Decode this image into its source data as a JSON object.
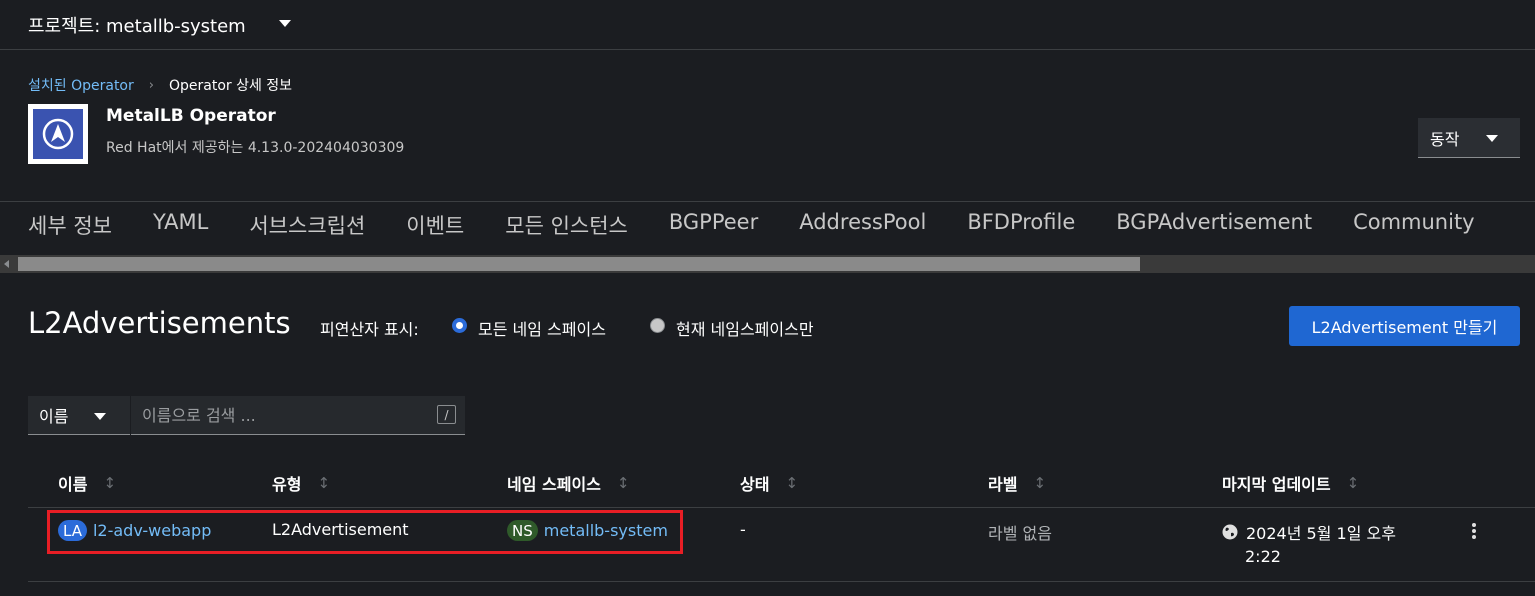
{
  "project": {
    "label": "프로젝트: metallb-system"
  },
  "breadcrumb": {
    "parent": "설치된 Operator",
    "current": "Operator 상세 정보"
  },
  "operator": {
    "name": "MetalLB Operator",
    "subtitle": "Red Hat에서 제공하는 4.13.0-202404030309"
  },
  "actions": {
    "label": "동작"
  },
  "tabs": [
    "세부 정보",
    "YAML",
    "서브스크립션",
    "이벤트",
    "모든 인스턴스",
    "BGPPeer",
    "AddressPool",
    "BFDProfile",
    "BGPAdvertisement",
    "Community"
  ],
  "page": {
    "title": "L2Advertisements"
  },
  "filter": {
    "label": "피연산자 표시:",
    "option_all": "모든 네임 스페이스",
    "option_current": "현재 네임스페이스만"
  },
  "create_button": "L2Advertisement 만들기",
  "search": {
    "select_value": "이름",
    "placeholder": "이름으로 검색 ...",
    "shortcut": "/"
  },
  "table": {
    "headers": [
      "이름",
      "유형",
      "네임 스페이스",
      "상태",
      "라벨",
      "마지막 업데이트"
    ],
    "rows": [
      {
        "name_badge": "LA",
        "name": "l2-adv-webapp",
        "type": "L2Advertisement",
        "ns_badge": "NS",
        "namespace": "metallb-system",
        "status": "-",
        "labels": "라벨 없음",
        "updated_line1": "2024년 5월 1일 오후",
        "updated_line2": "2:22"
      }
    ]
  },
  "colors": {
    "accent": "#1f67d2",
    "link": "#73bcf7",
    "highlight": "#e81e25",
    "background": "#1b1d21"
  }
}
